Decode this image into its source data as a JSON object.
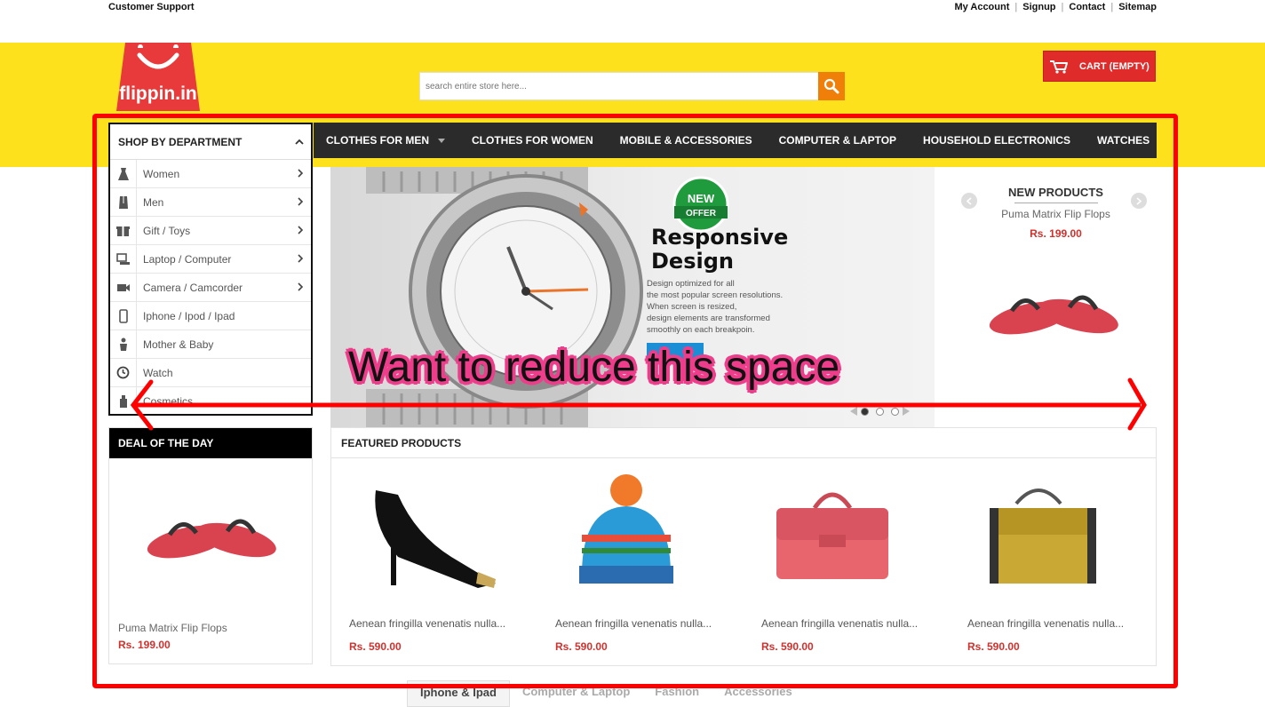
{
  "top_bar": {
    "support_label": "Customer Support",
    "links": [
      {
        "label": "My Account"
      },
      {
        "label": "Signup"
      },
      {
        "label": "Contact"
      },
      {
        "label": "Sitemap"
      }
    ]
  },
  "header": {
    "logo_text": "flippin.in",
    "search_placeholder": "search entire store here...",
    "cart_label": "CART (EMPTY)",
    "colors": {
      "band": "#fde11c",
      "logo": "#e83a3a",
      "cart": "#e02b2b",
      "search_button": "#f07f0a"
    }
  },
  "nav": {
    "items": [
      {
        "label": "CLOTHES FOR MEN",
        "has_dropdown": true
      },
      {
        "label": "CLOTHES FOR WOMEN"
      },
      {
        "label": "MOBILE & ACCESSORIES"
      },
      {
        "label": "COMPUTER & LAPTOP"
      },
      {
        "label": "HOUSEHOLD ELECTRONICS"
      },
      {
        "label": "WATCHES"
      }
    ]
  },
  "sidebar": {
    "title": "SHOP BY DEPARTMENT",
    "items": [
      {
        "label": "Women",
        "icon": "dress-icon",
        "has_submenu": true
      },
      {
        "label": "Men",
        "icon": "suit-icon",
        "has_submenu": true
      },
      {
        "label": "Gift / Toys",
        "icon": "gift-icon",
        "has_submenu": true
      },
      {
        "label": "Laptop / Computer",
        "icon": "computer-icon",
        "has_submenu": true
      },
      {
        "label": "Camera / Camcorder",
        "icon": "camcorder-icon",
        "has_submenu": true
      },
      {
        "label": "Iphone / Ipod / Ipad",
        "icon": "phone-icon",
        "has_submenu": false
      },
      {
        "label": "Mother & Baby",
        "icon": "baby-icon",
        "has_submenu": false
      },
      {
        "label": "Watch",
        "icon": "clock-icon",
        "has_submenu": false
      },
      {
        "label": "Cosmetics",
        "icon": "bottle-icon",
        "has_submenu": false
      }
    ]
  },
  "slider": {
    "badge_line1": "NEW",
    "badge_line2": "OFFER",
    "title_line1": "Responsive",
    "title_line2": "Design",
    "body": [
      "Design optimized for all",
      "the most popular screen resolutions.",
      "When screen is resized,",
      "design elements are transformed",
      "smoothly on each breakpoin."
    ],
    "active_slide": 1,
    "slide_count": 3
  },
  "new_products": {
    "title": "NEW PRODUCTS",
    "product_name": "Puma Matrix Flip Flops",
    "price": "Rs. 199.00"
  },
  "deal": {
    "title": "DEAL OF THE DAY",
    "product_name": "Puma Matrix Flip Flops",
    "price": "Rs. 199.00"
  },
  "featured": {
    "title": "FEATURED PRODUCTS",
    "products": [
      {
        "name": "Aenean fringilla venenatis nulla...",
        "price": "Rs. 590.00",
        "image": "high-heel-shoe"
      },
      {
        "name": "Aenean fringilla venenatis nulla...",
        "price": "Rs. 590.00",
        "image": "knit-beanie"
      },
      {
        "name": "Aenean fringilla venenatis nulla...",
        "price": "Rs. 590.00",
        "image": "pink-satchel"
      },
      {
        "name": "Aenean fringilla venenatis nulla...",
        "price": "Rs. 590.00",
        "image": "mustard-handbag"
      }
    ]
  },
  "bottom_tabs": {
    "items": [
      {
        "label": "Iphone & Ipad",
        "active": true
      },
      {
        "label": "Computer & Laptop"
      },
      {
        "label": "Fashion"
      },
      {
        "label": "Accessories"
      }
    ]
  },
  "annotation": {
    "text": "Want to reduce this space",
    "color": "#ff0000",
    "highlight": "#ee3d8b"
  }
}
